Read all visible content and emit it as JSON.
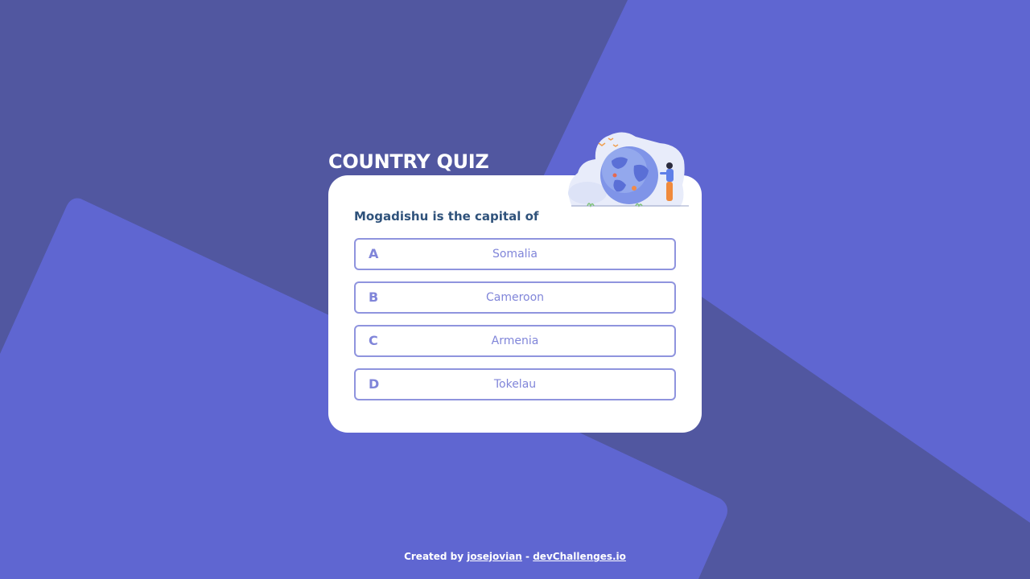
{
  "page": {
    "title": "COUNTRY QUIZ"
  },
  "quiz": {
    "question": "Mogadishu is the capital of",
    "options": [
      {
        "letter": "A",
        "text": "Somalia"
      },
      {
        "letter": "B",
        "text": "Cameroon"
      },
      {
        "letter": "C",
        "text": "Armenia"
      },
      {
        "letter": "D",
        "text": "Tokelau"
      }
    ]
  },
  "footer": {
    "prefix": "Created by",
    "author": "josejovian",
    "separator": "-",
    "site": "devChallenges.io"
  },
  "colors": {
    "background": "#5157a0",
    "shape": "#5f66d1",
    "card": "#ffffff",
    "question": "#2f527b",
    "option_accent": "#6066d0",
    "title": "#ffffff"
  }
}
